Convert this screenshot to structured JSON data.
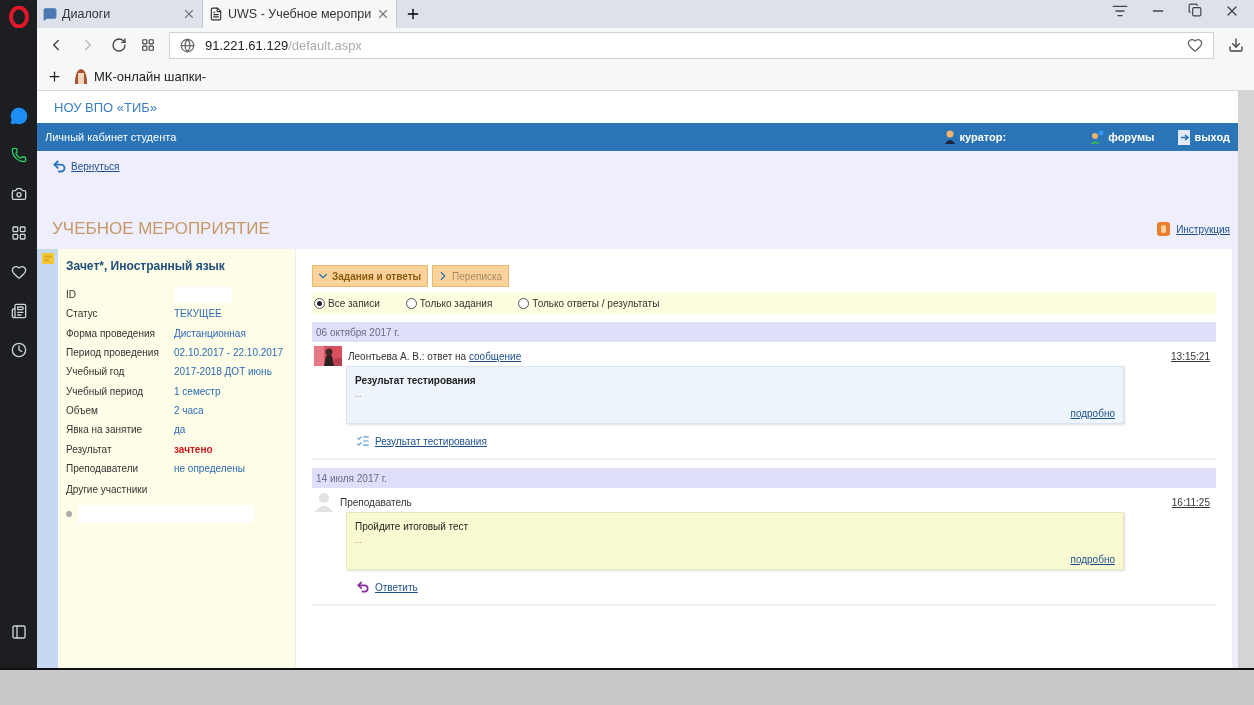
{
  "browser": {
    "tabs": [
      {
        "title": "Диалоги",
        "selected": false,
        "kind": "chat"
      },
      {
        "title": "UWS - Учебное меропри",
        "selected": true,
        "kind": "page"
      }
    ],
    "address": {
      "host": "91.221.61.129",
      "path": "/default.aspx"
    },
    "bookmarks": [
      {
        "label": "МК-онлайн шапки-"
      }
    ]
  },
  "site": {
    "name": "НОУ ВПО «ТИБ»",
    "bar_title": "Личный кабинет студента",
    "bar_links": [
      {
        "label": "куратор:",
        "kind": "curator"
      },
      {
        "label": "форумы",
        "kind": "forums"
      },
      {
        "label": "выход",
        "kind": "exit"
      }
    ],
    "back_link": "Вернуться",
    "page_title": "УЧЕБНОЕ МЕРОПРИЯТИЕ",
    "instruction_link": "Инструкция"
  },
  "course": {
    "title": "Зачет*, Иностранный язык",
    "fields": [
      {
        "label": "ID",
        "kind": "redacted"
      },
      {
        "label": "Статус",
        "value": "ТЕКУЩЕЕ",
        "kind": "text"
      },
      {
        "label": "Форма проведения",
        "value": "Дистанционная",
        "kind": "text"
      },
      {
        "label": "Период проведения",
        "value": "02.10.2017 - 22.10.2017",
        "kind": "text"
      },
      {
        "label": "Учебный год",
        "value": "2017-2018 ДОТ июнь",
        "kind": "text"
      },
      {
        "label": "Учебный период",
        "value": "1 семестр",
        "kind": "text"
      },
      {
        "label": "Объем",
        "value": "2 часа",
        "kind": "text"
      },
      {
        "label": "Явка на занятие",
        "value": "да",
        "kind": "text"
      },
      {
        "label": "Результат",
        "value": "зачтено",
        "kind": "result"
      },
      {
        "label": "Преподаватели",
        "value": "не определены",
        "kind": "text"
      }
    ],
    "participants_label": "Другие участники"
  },
  "view_tabs": [
    {
      "label": "Задания и ответы",
      "selected": true
    },
    {
      "label": "Переписка",
      "selected": false
    }
  ],
  "filters": [
    {
      "label": "Все записи",
      "selected": true
    },
    {
      "label": "Только задания",
      "selected": false
    },
    {
      "label": "Только ответы / результаты",
      "selected": false
    }
  ],
  "groups": [
    {
      "date": "06 октября 2017 г.",
      "messages": [
        {
          "has_photo": true,
          "author": "Леонтьева А. В.: ответ на",
          "author_link": "сообщение",
          "time": "13:15:21",
          "kind": "response",
          "body_title": "Результат тестирования",
          "body_more": "...",
          "details_link": "подробно",
          "action": {
            "kind": "attachment",
            "label": "Результат тестирования"
          }
        }
      ]
    },
    {
      "date": "14 июля 2017 г.",
      "messages": [
        {
          "has_photo": false,
          "author": "Преподаватель",
          "time": "16:11:25",
          "kind": "task",
          "body_title": "Пройдите итоговый тест",
          "body_more": "...",
          "details_link": "подробно",
          "action": {
            "kind": "reply",
            "label": "Ответить"
          }
        }
      ]
    }
  ]
}
